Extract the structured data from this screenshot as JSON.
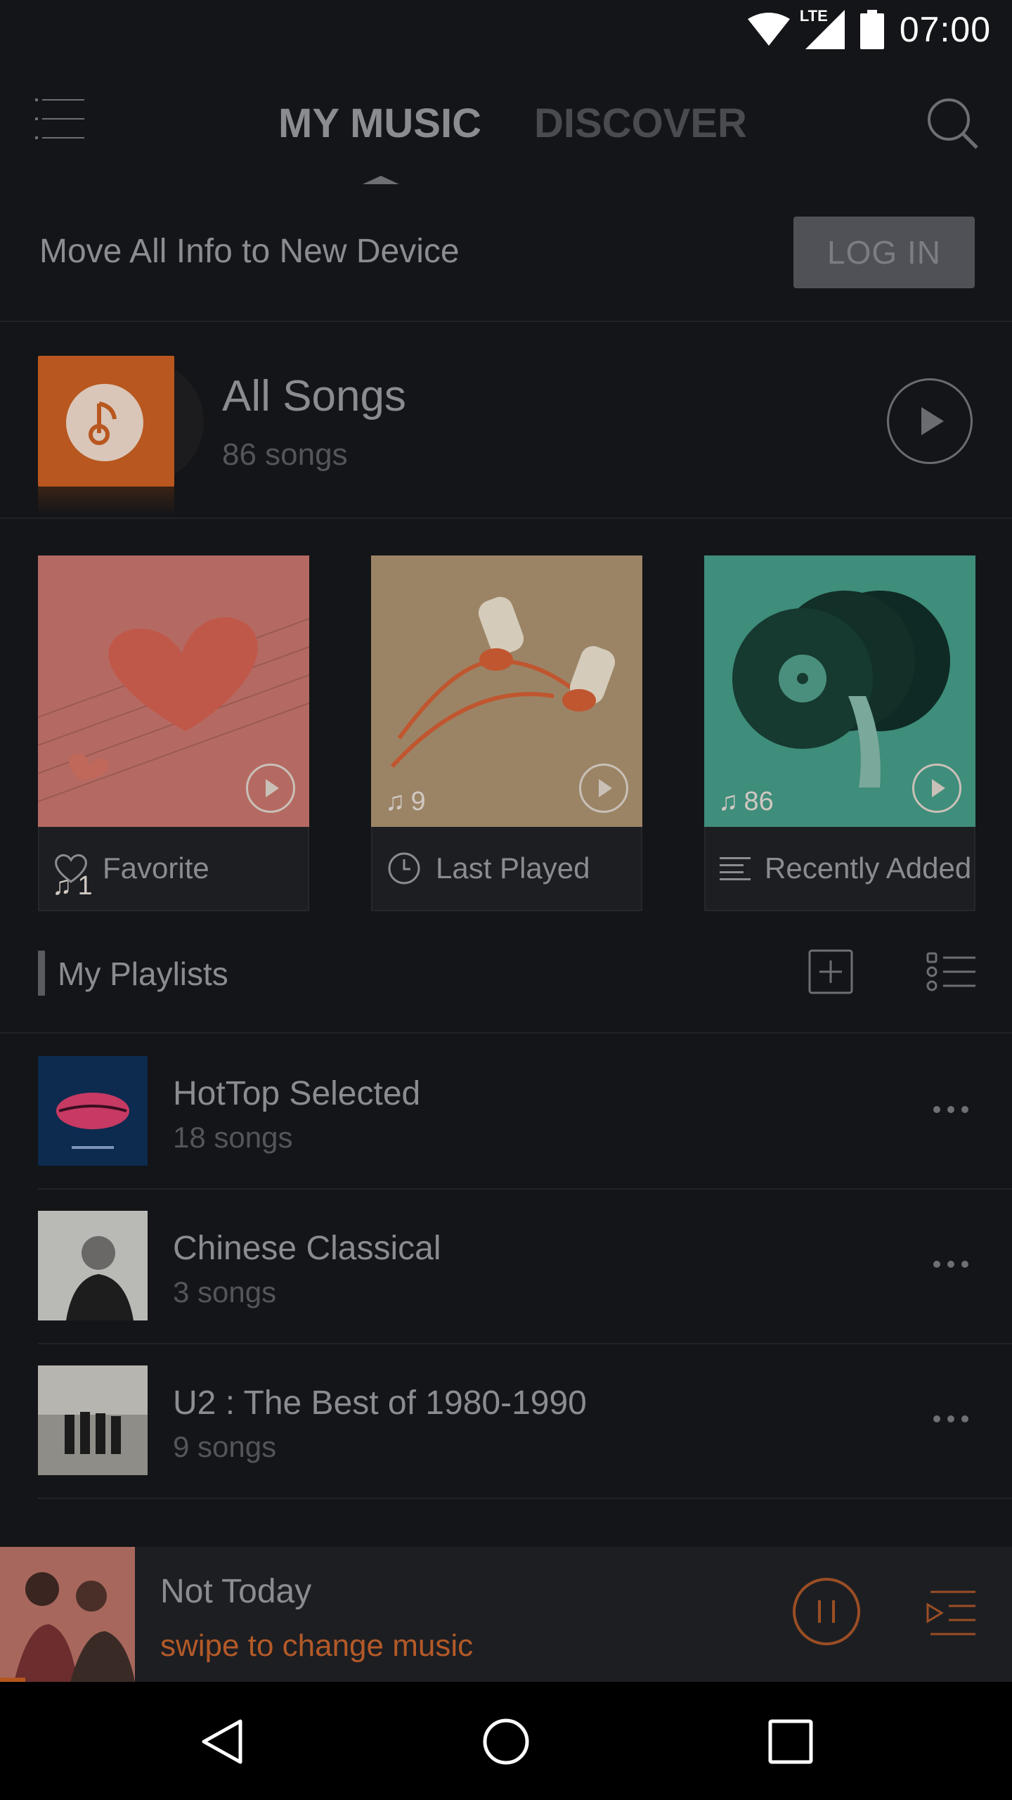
{
  "status_bar": {
    "network": "LTE",
    "time": "07:00"
  },
  "header": {
    "tabs": [
      {
        "label": "MY MUSIC",
        "selected": true
      },
      {
        "label": "DISCOVER",
        "selected": false
      }
    ]
  },
  "login_banner": {
    "text": "Move All Info to New Device",
    "button": "LOG IN"
  },
  "all_songs": {
    "title": "All Songs",
    "subtitle": "86 songs"
  },
  "cards": [
    {
      "label": "Favorite",
      "count": "1",
      "icon": "heart-outline-icon",
      "color": "#b46a62"
    },
    {
      "label": "Last Played",
      "count": "9",
      "icon": "clock-icon",
      "color": "#9b8466"
    },
    {
      "label": "Recently Added",
      "count": "86",
      "icon": "list-icon",
      "color": "#3f8d7b"
    }
  ],
  "playlists": {
    "title": "My Playlists",
    "items": [
      {
        "name": "HotTop Selected",
        "count": "18 songs"
      },
      {
        "name": "Chinese Classical",
        "count": "3 songs"
      },
      {
        "name": "U2 : The Best of 1980-1990",
        "count": "9 songs"
      }
    ]
  },
  "player": {
    "title": "Not Today",
    "subtitle": "swipe to change music",
    "progress": 0.025,
    "accent": "#b35a28"
  }
}
